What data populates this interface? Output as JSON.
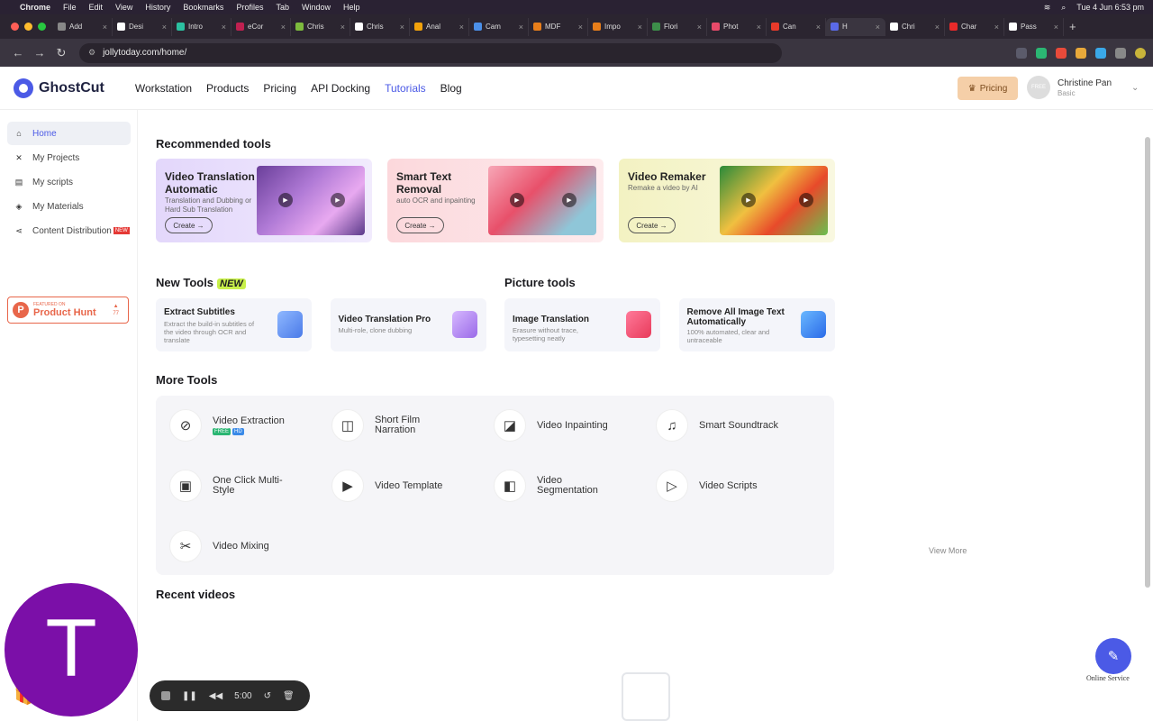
{
  "os_menubar": {
    "apple": "",
    "app": "Chrome",
    "menus": [
      "File",
      "Edit",
      "View",
      "History",
      "Bookmarks",
      "Profiles",
      "Tab",
      "Window",
      "Help"
    ],
    "clock": "Tue 4 Jun  6:53 pm"
  },
  "browser": {
    "tabs": [
      {
        "label": "Add",
        "color": "#888"
      },
      {
        "label": "Desi",
        "color": "#fff"
      },
      {
        "label": "Intro",
        "color": "#2bc0a0"
      },
      {
        "label": "eCor",
        "color": "#c02050"
      },
      {
        "label": "Chris",
        "color": "#7dbb3d"
      },
      {
        "label": "Chris",
        "color": "#fff"
      },
      {
        "label": "Anal",
        "color": "#f2a20b"
      },
      {
        "label": "Cam",
        "color": "#4b8fe8"
      },
      {
        "label": "MDF",
        "color": "#e87e1a"
      },
      {
        "label": "Impo",
        "color": "#e87e1a"
      },
      {
        "label": "Flori",
        "color": "#3d8e4a"
      },
      {
        "label": "Phot",
        "color": "#e84a6a"
      },
      {
        "label": "Can",
        "color": "#e83a2a"
      },
      {
        "label": "H",
        "color": "#5a6ae8"
      },
      {
        "label": "Chri",
        "color": "#fff"
      },
      {
        "label": "Char",
        "color": "#e82a2a"
      },
      {
        "label": "Pass",
        "color": "#fff"
      }
    ],
    "url": "jollytoday.com/home/"
  },
  "topnav": {
    "brand": "GhostCut",
    "links": [
      "Workstation",
      "Products",
      "Pricing",
      "API Docking",
      "Tutorials",
      "Blog"
    ],
    "active_link": "Tutorials",
    "pricing_button": "Pricing",
    "user_name": "Christine Pan",
    "user_plan": "Basic",
    "avatar_text": "FREE"
  },
  "sidebar": {
    "items": [
      {
        "label": "Home",
        "icon": "home-icon",
        "glyph": "⌂"
      },
      {
        "label": "My Projects",
        "icon": "projects-icon",
        "glyph": "✕"
      },
      {
        "label": "My scripts",
        "icon": "scripts-icon",
        "glyph": "▤"
      },
      {
        "label": "My Materials",
        "icon": "materials-icon",
        "glyph": "◈"
      },
      {
        "label": "Content Distribution",
        "icon": "share-icon",
        "glyph": "⋖"
      }
    ],
    "new_badge": "NEW",
    "product_hunt": {
      "line1": "FEATURED ON",
      "line2": "Product Hunt",
      "count": "77"
    }
  },
  "sections": {
    "recommended": "Recommended tools",
    "new_tools": "New Tools",
    "new_tag": "NEW",
    "picture_tools": "Picture tools",
    "more_tools": "More Tools",
    "recent_videos": "Recent videos",
    "view_more": "View More"
  },
  "recommended_tools": [
    {
      "title": "Video Translation Automatic",
      "subtitle": "Translation and Dubbing or Hard Sub Translation",
      "button": "Create →",
      "bg": "#e3d7fb"
    },
    {
      "title": "Smart Text Removal",
      "subtitle": "auto OCR and inpainting",
      "button": "Create →",
      "bg": "#fcd8dc"
    },
    {
      "title": "Video Remaker",
      "subtitle": "Remake a video by AI",
      "button": "Create →",
      "bg": "#f3f2c2"
    }
  ],
  "new_tools": [
    {
      "title": "Extract Subtitles",
      "subtitle": "Extract the build-in subtitles of the video through OCR and translate"
    },
    {
      "title": "Video Translation Pro",
      "subtitle": "Multi-role, clone dubbing"
    }
  ],
  "picture_tools": [
    {
      "title": "Image Translation",
      "subtitle": "Erasure without trace, typesetting neatly"
    },
    {
      "title": "Remove All Image Text Automatically",
      "subtitle": "100% automated, clear and untraceable"
    }
  ],
  "more_tools": [
    {
      "label": "Video Extraction",
      "icon": "video-extraction-icon",
      "glyph": "⊘",
      "tags": [
        "FREE",
        "HD"
      ]
    },
    {
      "label": "Short Film Narration",
      "icon": "narration-icon",
      "glyph": "◫"
    },
    {
      "label": "Video Inpainting",
      "icon": "inpainting-icon",
      "glyph": "◪"
    },
    {
      "label": "Smart Soundtrack",
      "icon": "soundtrack-icon",
      "glyph": "♫"
    },
    {
      "label": "One Click Multi-Style",
      "icon": "multi-style-icon",
      "glyph": "▣"
    },
    {
      "label": "Video Template",
      "icon": "template-icon",
      "glyph": "▶"
    },
    {
      "label": "Video Segmentation",
      "icon": "segmentation-icon",
      "glyph": "◧"
    },
    {
      "label": "Video Scripts",
      "icon": "scripts-icon",
      "glyph": "▷"
    },
    {
      "label": "Video Mixing",
      "icon": "mixing-icon",
      "glyph": "✂"
    }
  ],
  "service": {
    "label": "Online Service"
  },
  "webcam": {
    "initial": "T"
  },
  "recorder": {
    "time": "5:00"
  }
}
